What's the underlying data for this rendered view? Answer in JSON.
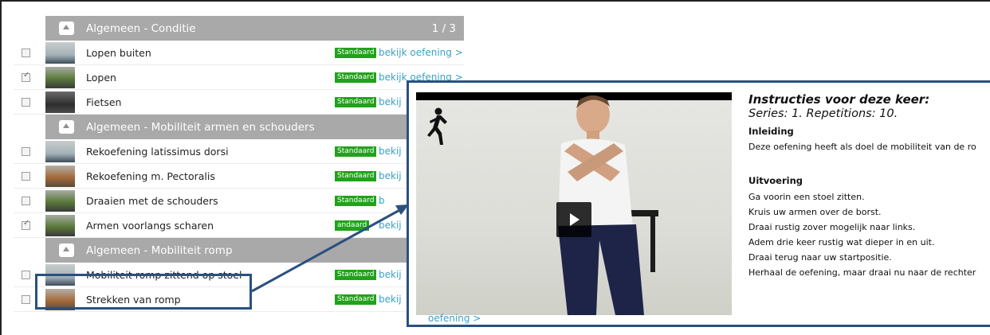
{
  "sections": [
    {
      "title": "Algemeen - Conditie",
      "page": "1 / 3",
      "rows": [
        {
          "name": "Lopen buiten",
          "badge": "Standaard",
          "link": "bekijk oefening >",
          "checked": false,
          "thumb": "pale"
        },
        {
          "name": "Lopen",
          "badge": "Standaard",
          "link": "bekijk oefening >",
          "checked": true,
          "thumb": "green"
        },
        {
          "name": "Fietsen",
          "badge": "Standaard",
          "link": "bekij",
          "checked": false,
          "thumb": "dark"
        }
      ]
    },
    {
      "title": "Algemeen - Mobiliteit armen en schouders",
      "page": "",
      "rows": [
        {
          "name": "Rekoefening latissimus dorsi",
          "badge": "Standaard",
          "link": "bekij",
          "checked": false,
          "thumb": "pale"
        },
        {
          "name": "Rekoefening m. Pectoralis",
          "badge": "Standaard",
          "link": "bekij",
          "checked": false,
          "thumb": "warm"
        },
        {
          "name": "Draaien met de schouders",
          "badge": "Standaard",
          "link": "b",
          "checked": false,
          "thumb": "green"
        },
        {
          "name": "Armen voorlangs scharen",
          "badge": "andaard",
          "link": "bekij",
          "checked": true,
          "thumb": "green"
        }
      ]
    },
    {
      "title": "Algemeen - Mobiliteit romp",
      "page": "",
      "rows": [
        {
          "name": "Mobiliteit romp zittend op stoel",
          "badge": "Standaard",
          "link": "bekij",
          "checked": false,
          "thumb": "pale"
        },
        {
          "name": "Strekken van romp",
          "badge": "Standaard",
          "link": "bekij",
          "checked": false,
          "thumb": "warm"
        }
      ]
    }
  ],
  "footer_link": "oefening >",
  "detail": {
    "instructions_title": "Instructies voor deze keer:",
    "series_line": "Series: 1. Repetitions: 10.",
    "intro_heading": "Inleiding",
    "intro_text": "Deze oefening heeft als doel de mobiliteit van de ro",
    "execution_heading": "Uitvoering",
    "steps": [
      "Ga voorin een stoel zitten.",
      "Kruis uw armen over de borst.",
      "Draai rustig zover mogelijk naar links.",
      "Adem drie keer rustig wat dieper in en uit.",
      "Draai terug naar uw startpositie.",
      "Herhaal de oefening, maar draai nu  naar de rechter"
    ]
  },
  "colors": {
    "section_header": "#a9a9a9",
    "badge_green": "#21a21b",
    "link_blue": "#3aa0c6",
    "highlight_border": "#2a5080"
  }
}
